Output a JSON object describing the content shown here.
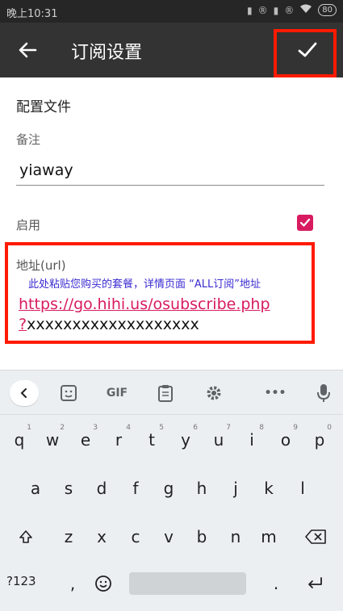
{
  "status_bar": {
    "time": "晚上10:31",
    "battery": "80",
    "icons": [
      "signal-icon",
      "r-icon",
      "signal-icon",
      "r-icon",
      "wifi-icon",
      "battery-icon"
    ]
  },
  "app_bar": {
    "title": "订阅设置",
    "back_icon": "arrow-left-icon",
    "confirm_icon": "check-icon"
  },
  "form": {
    "section_title": "配置文件",
    "note_label": "备注",
    "note_value": "yiaway",
    "enable_label": "启用",
    "enable_checked": true,
    "address_label": "地址(url)",
    "annotation": "此处粘贴您购买的套餐，详情页面 “ALL订阅”地址",
    "url_part1": "https://go.hihi.us/osubscribe.php",
    "url_part2_q": "?",
    "url_part2_rest": "xxxxxxxxxxxxxxxxxxx"
  },
  "keyboard": {
    "toolbar": {
      "gif_label": "GIF",
      "more_label": "•••"
    },
    "row1": [
      {
        "key": "q",
        "hint": "1"
      },
      {
        "key": "w",
        "hint": "2"
      },
      {
        "key": "e",
        "hint": "3"
      },
      {
        "key": "r",
        "hint": "4"
      },
      {
        "key": "t",
        "hint": "5"
      },
      {
        "key": "y",
        "hint": "6"
      },
      {
        "key": "u",
        "hint": "7"
      },
      {
        "key": "i",
        "hint": "8"
      },
      {
        "key": "o",
        "hint": "9"
      },
      {
        "key": "p",
        "hint": "0"
      }
    ],
    "row2": [
      "a",
      "s",
      "d",
      "f",
      "g",
      "h",
      "j",
      "k",
      "l"
    ],
    "row3": [
      "z",
      "x",
      "c",
      "v",
      "b",
      "n",
      "m"
    ],
    "bottom": {
      "symbols_label": "?123",
      "comma": ",",
      "period": "."
    }
  },
  "colors": {
    "accent": "#d81b60",
    "highlight": "#ff1a00",
    "annotation": "#3a2bd1"
  }
}
